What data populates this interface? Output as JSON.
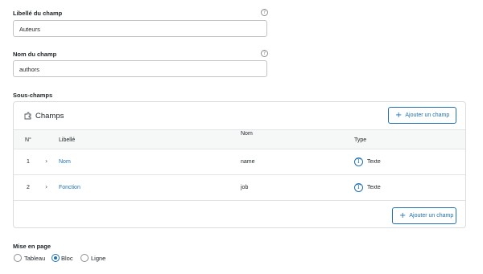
{
  "field_label": {
    "label": "Libellé du champ",
    "value": "Auteurs",
    "help_icon": "question-circle-icon"
  },
  "field_name": {
    "label": "Nom du champ",
    "value": "authors",
    "help_icon": "question-circle-icon"
  },
  "subfields": {
    "section_label": "Sous-champs",
    "panel_title": "Champs",
    "panel_icon": "puzzle-icon",
    "add_button_label": "Ajouter un champ",
    "columns": {
      "number": "N°",
      "label": "Libellé",
      "name": "Nom",
      "type": "Type"
    },
    "rows": [
      {
        "number": "1",
        "label": "Nom",
        "name": "name",
        "type": "Texte",
        "type_icon": "text-type-icon"
      },
      {
        "number": "2",
        "label": "Fonction",
        "name": "job",
        "type": "Texte",
        "type_icon": "text-type-icon"
      }
    ]
  },
  "layout": {
    "label": "Mise en page",
    "options": [
      {
        "label": "Tableau",
        "selected": false
      },
      {
        "label": "Bloc",
        "selected": true
      },
      {
        "label": "Ligne",
        "selected": false
      }
    ]
  },
  "colors": {
    "accent": "#2271b1",
    "border": "#dcdcde",
    "header_bg": "#f6f7f7"
  }
}
